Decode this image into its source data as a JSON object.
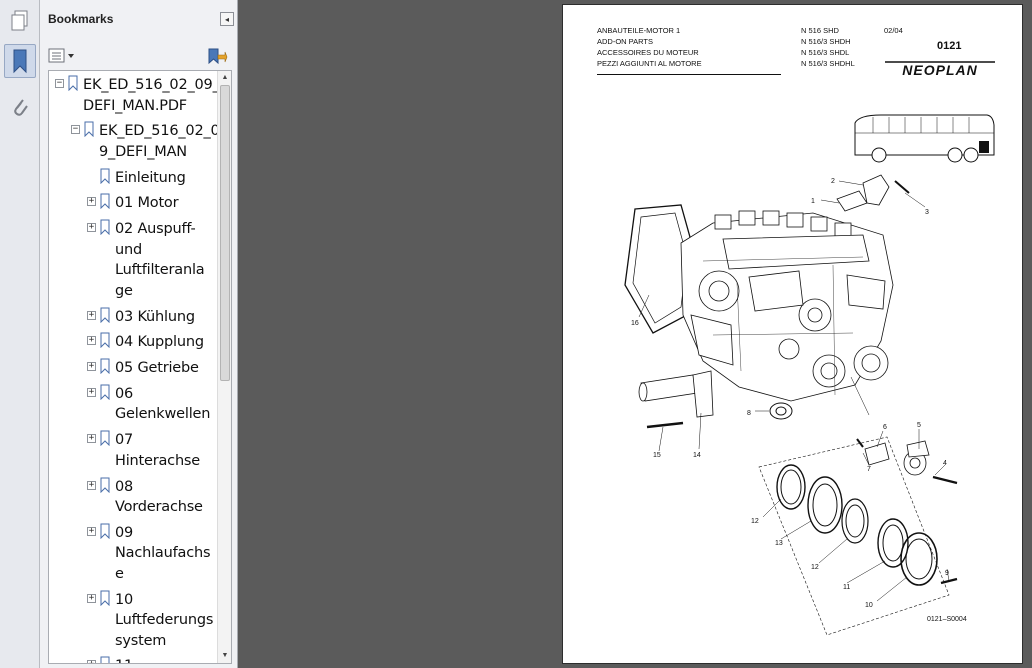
{
  "sidebar": {
    "title": "Bookmarks",
    "tree": [
      {
        "label_lines": [
          "EK_ED_516_02_09_",
          "DEFI_MAN.PDF"
        ],
        "expander": "minus"
      },
      {
        "label_lines": [
          "EK_ED_516_02_0",
          "9_DEFI_MAN"
        ],
        "expander": "minus"
      },
      {
        "label_lines": [
          "Einleitung"
        ],
        "expander": "none"
      },
      {
        "label_lines": [
          "01 Motor"
        ],
        "expander": "plus"
      },
      {
        "label_lines": [
          "02 Auspuff-",
          "und",
          "Luftfilteranla",
          "ge"
        ],
        "expander": "plus"
      },
      {
        "label_lines": [
          "03 Kühlung"
        ],
        "expander": "plus"
      },
      {
        "label_lines": [
          "04 Kupplung"
        ],
        "expander": "plus"
      },
      {
        "label_lines": [
          "05 Getriebe"
        ],
        "expander": "plus"
      },
      {
        "label_lines": [
          "06",
          "Gelenkwellen"
        ],
        "expander": "plus"
      },
      {
        "label_lines": [
          "07",
          "Hinterachse"
        ],
        "expander": "plus"
      },
      {
        "label_lines": [
          "08",
          "Vorderachse"
        ],
        "expander": "plus"
      },
      {
        "label_lines": [
          "09",
          "Nachlaufachs",
          "e"
        ],
        "expander": "plus"
      },
      {
        "label_lines": [
          "10",
          "Luftfederungs",
          "system"
        ],
        "expander": "plus"
      },
      {
        "label_lines": [
          "11"
        ],
        "expander": "plus"
      }
    ]
  },
  "document": {
    "header_titles": [
      "ANBAUTEILE-MOTOR 1",
      "ADD-ON PARTS",
      "ACCESSOIRES DU MOTEUR",
      "PEZZI AGGIUNTI AL MOTORE"
    ],
    "models": [
      "N 516 SHD",
      "N 516/3 SHDH",
      "N 516/3 SHDL",
      "N 516/3 SHDHL"
    ],
    "date": "02/04",
    "sheet_number": "0121",
    "brand": "NEOPLAN",
    "drawing_id": "0121–S0004",
    "callouts": [
      "1",
      "2",
      "3",
      "4",
      "5",
      "6",
      "7",
      "8",
      "9",
      "10",
      "11",
      "12",
      "12",
      "13",
      "14",
      "15",
      "16"
    ]
  },
  "colors": {
    "workspace": "#5b5b5b",
    "panel": "#f0f1f4",
    "page": "#ffffff",
    "accent_blue": "#4a78b8"
  },
  "icons": {
    "rail": [
      "pages-icon",
      "bookmarks-icon",
      "attachments-icon"
    ],
    "toolbar": [
      "options-icon",
      "new-bookmark-icon"
    ]
  }
}
